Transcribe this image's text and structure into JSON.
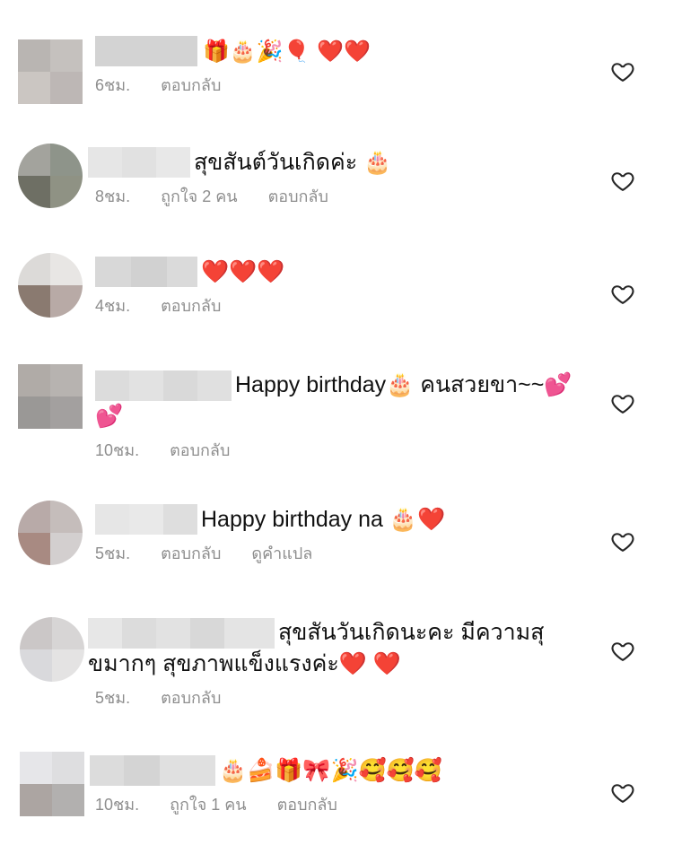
{
  "comments": [
    {
      "text": "🎁🎂🎉🎈 ❤️❤️",
      "time": "6ชม.",
      "reply": "ตอบกลับ",
      "avatar_colors": [
        "#b9b5b2",
        "#c5c1be",
        "#cbc6c2",
        "#bdb7b5"
      ],
      "redact_colors": [
        "#d3d3d3",
        "#cfcfcf",
        "#d6d6d6"
      ]
    },
    {
      "text": "สุขสันต์วันเกิดค่ะ 🎂",
      "time": "8ชม.",
      "likes": "ถูกใจ 2 คน",
      "reply": "ตอบกลับ",
      "avatar_colors": [
        "#a3a39d",
        "#8e948a",
        "#6e6f64",
        "#8f9284"
      ],
      "redact_colors": [
        "#e6e6e6",
        "#e1e1e1",
        "#e8e8e8"
      ]
    },
    {
      "text": "❤️❤️❤️",
      "time": "4ชม.",
      "reply": "ตอบกลับ",
      "avatar_colors": [
        "#dcdad8",
        "#e8e6e4",
        "#8a7a70",
        "#b8aaa6"
      ],
      "redact_colors": [
        "#d8d8d8",
        "#d1d1d1",
        "#dadada"
      ]
    },
    {
      "text": "Happy birthday🎂 คนสวยขา~~💕 💕",
      "time": "10ชม.",
      "reply": "ตอบกลับ",
      "avatar_colors": [
        "#b0aba7",
        "#b7b3b0",
        "#9a9896",
        "#a3a09f"
      ],
      "redact_colors": [
        "#dcdcdc",
        "#e2e2e2",
        "#d9d9d9",
        "#e0e0e0"
      ]
    },
    {
      "text": "Happy birthday na 🎂❤️",
      "time": "5ชม.",
      "reply": "ตอบกลับ",
      "translate": "ดูคำแปล",
      "avatar_colors": [
        "#b8aaa8",
        "#c5bdbb",
        "#a88a82",
        "#d3cfcf"
      ],
      "redact_colors": [
        "#e6e6e6",
        "#e9e9e9",
        "#dedede"
      ]
    },
    {
      "text": "สุขสันวันเกิดนะคะ มีความสุขมากๆ สุขภาพแข็งแรงค่ะ❤️ ❤️",
      "time": "5ชม.",
      "reply": "ตอบกลับ",
      "avatar_colors": [
        "#cbc7c7",
        "#d7d5d5",
        "#d9d9dc",
        "#e4e3e3"
      ],
      "redact_colors": [
        "#e7e7e7",
        "#dcdcdc",
        "#e2e2e2",
        "#d8d8d8",
        "#e4e4e4"
      ]
    },
    {
      "text": "🎂🍰🎁🎀🎉🥰🥰🥰",
      "time": "10ชม.",
      "likes": "ถูกใจ 1 คน",
      "reply": "ตอบกลับ",
      "avatar_colors": [
        "#e6e6e9",
        "#dedee0",
        "#aca5a2",
        "#b2b0af"
      ],
      "redact_colors": [
        "#dcdcdc",
        "#d4d4d4",
        "#e0e0e0"
      ]
    }
  ],
  "icons": {
    "like": "heart-outline-icon"
  }
}
